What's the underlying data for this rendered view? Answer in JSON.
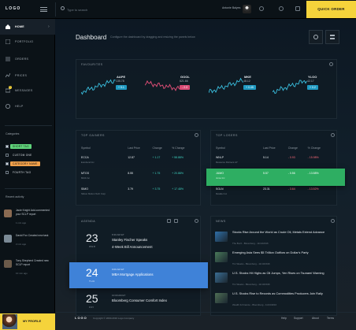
{
  "topbar": {
    "logo": "LOGO",
    "search_placeholder": "Type to search",
    "user_name": "Antonie Balyes",
    "quick_order": "QUICK ORDER"
  },
  "sidebar": {
    "nav": [
      "HOME",
      "PORTFOLIO",
      "ORDERS",
      "PRICES",
      "MESSAGES",
      "HELP"
    ],
    "messages_badge": "1",
    "categories_title": "Categories",
    "tags": [
      {
        "label": "SHORT TAG",
        "color": "#5fd37a",
        "checked": true
      },
      {
        "label": "CUSTOM ONE",
        "color": "",
        "checked": false
      },
      {
        "label": "CATEGORY NAME",
        "color": "#f0a04b",
        "checked": true
      },
      {
        "label": "FOURTH TAG",
        "color": "",
        "checked": false
      }
    ],
    "recent_title": "Recent activity",
    "activity": [
      {
        "text": "Jacie Knight Add-commented your SCLP report",
        "time": "1 min ago"
      },
      {
        "text": "David Fox Created new task",
        "time": "2 min ago"
      },
      {
        "text": "Tony Shepherd Created new SCLP report",
        "time": "10 min ago"
      }
    ],
    "profile": "MY PROFILE"
  },
  "main": {
    "title": "Dashboard",
    "subtitle": "Configure the dashboard by dragging and resizing the panels below",
    "favourites": {
      "title": "FAVOURITES",
      "items": [
        {
          "name": "AAPE",
          "value": "135.78",
          "change": "+ 5.1",
          "up": true,
          "color": "#3ac0e0"
        },
        {
          "name": "GOOL",
          "value": "621.66",
          "change": "- 2.3",
          "up": false,
          "color": "#e8507a"
        },
        {
          "name": "MKE",
          "value": "48.12",
          "change": "+ 0.45",
          "up": true,
          "color": "#3ac0e0"
        },
        {
          "name": "YLOO",
          "value": "42.17",
          "change": "+ 0.2",
          "up": true,
          "color": "#3ac0e0"
        }
      ]
    },
    "gainers": {
      "title": "TOP GAINERS",
      "columns": [
        "Symbol",
        "Last Price",
        "Change",
        "% Change"
      ],
      "rows": [
        {
          "symbol": "ECCA",
          "name": "Eurobond Inc",
          "price": "12.87",
          "change": "+ 1.17",
          "pct": "+ 58.88%"
        },
        {
          "symbol": "MTGS",
          "name": "MGS Inc",
          "price": "8.55",
          "change": "+ 1.75",
          "pct": "+ 20.88%"
        },
        {
          "symbol": "SIMO",
          "name": "Silicon Motion Tech Corp",
          "price": "3.79",
          "change": "+ 3.75",
          "pct": "+ 17.48%"
        }
      ]
    },
    "losers": {
      "title": "TOP LOSERS",
      "columns": [
        "Symbol",
        "Last Price",
        "Change",
        "% Change"
      ],
      "rows": [
        {
          "symbol": "WNLP",
          "name": "Resource Partners LP",
          "price": "5.14",
          "change": "- 0.93",
          "pct": "- 15.98%"
        },
        {
          "symbol": "JUMO",
          "name": "Jumo Inc",
          "price": "5.57",
          "change": "- 0.56",
          "pct": "- 13.58%"
        },
        {
          "symbol": "SGLN",
          "name": "Retailer Inc",
          "price": "23.31",
          "change": "- 3.64",
          "pct": "- 13.52%"
        }
      ]
    },
    "agenda": {
      "title": "AGENDA",
      "events": [
        {
          "day": "23",
          "month": "WED",
          "time": "8:30 AM ET",
          "title": "Stanley Fischer Speaks",
          "time2": "9:00 AM ET",
          "title2": "4-Week Bill Announcement"
        },
        {
          "day": "24",
          "month": "THU",
          "time": "9:00 AM ET",
          "title": "MBA Mortgage Applications",
          "time2": "",
          "title2": ""
        },
        {
          "day": "25",
          "month": "FRI",
          "time": "10:00 AM ET",
          "title": "Bloomberg Consumer Comfort Index",
          "time2": "",
          "title2": ""
        }
      ]
    },
    "news": {
      "title": "NEWS",
      "items": [
        {
          "headline": "Stocks Rise Around the World as Crude Oil, Metals Extend Advance",
          "meta": "The Buzz - Bloomberg - 11/13/2016"
        },
        {
          "headline": "Emerging Asia Sees $5 Trillion Outflow on Dollar's Party",
          "meta": "Tim Weeks - Bloomberg - 11/13/2016"
        },
        {
          "headline": "U.S. Stocks Hit Highs as Oil Jumps, Yen Rises on Tsunami Warning",
          "meta": "Tim Weeks - Bloomberg - 11/13/2016"
        },
        {
          "headline": "U.S. Stocks Rise to Records as Commodities Producers Join Rally",
          "meta": "Wealth & Finance - Bloomberg - 11/13/2016"
        }
      ]
    }
  },
  "footer": {
    "logo": "LOGO",
    "copyright": "Copyright © 2000-2016 Logo Company",
    "links": [
      "Help",
      "Support",
      "About",
      "Terms"
    ]
  }
}
